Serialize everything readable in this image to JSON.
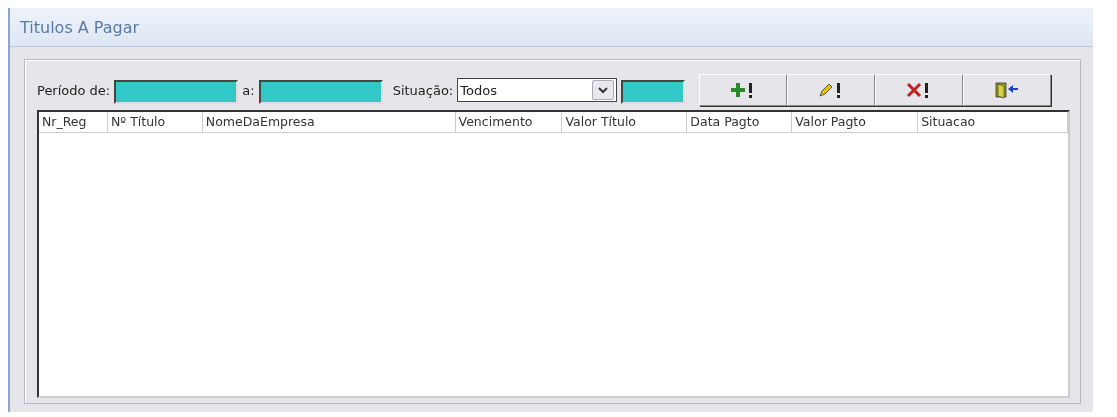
{
  "window": {
    "title": "Titulos A Pagar"
  },
  "filters": {
    "period_from_label": "Período de:",
    "period_to_label": "a:",
    "status_label": "Situação:",
    "status_value": "Todos"
  },
  "buttons": [
    {
      "kind": "add"
    },
    {
      "kind": "edit"
    },
    {
      "kind": "delete"
    },
    {
      "kind": "exit"
    }
  ],
  "table": {
    "columns": [
      "Nr_Reg",
      "Nº Título",
      "NomeDaEmpresa",
      "Vencimento",
      "Valor Título",
      "Data Pagto",
      "Valor Pagto",
      "Situacao"
    ]
  }
}
